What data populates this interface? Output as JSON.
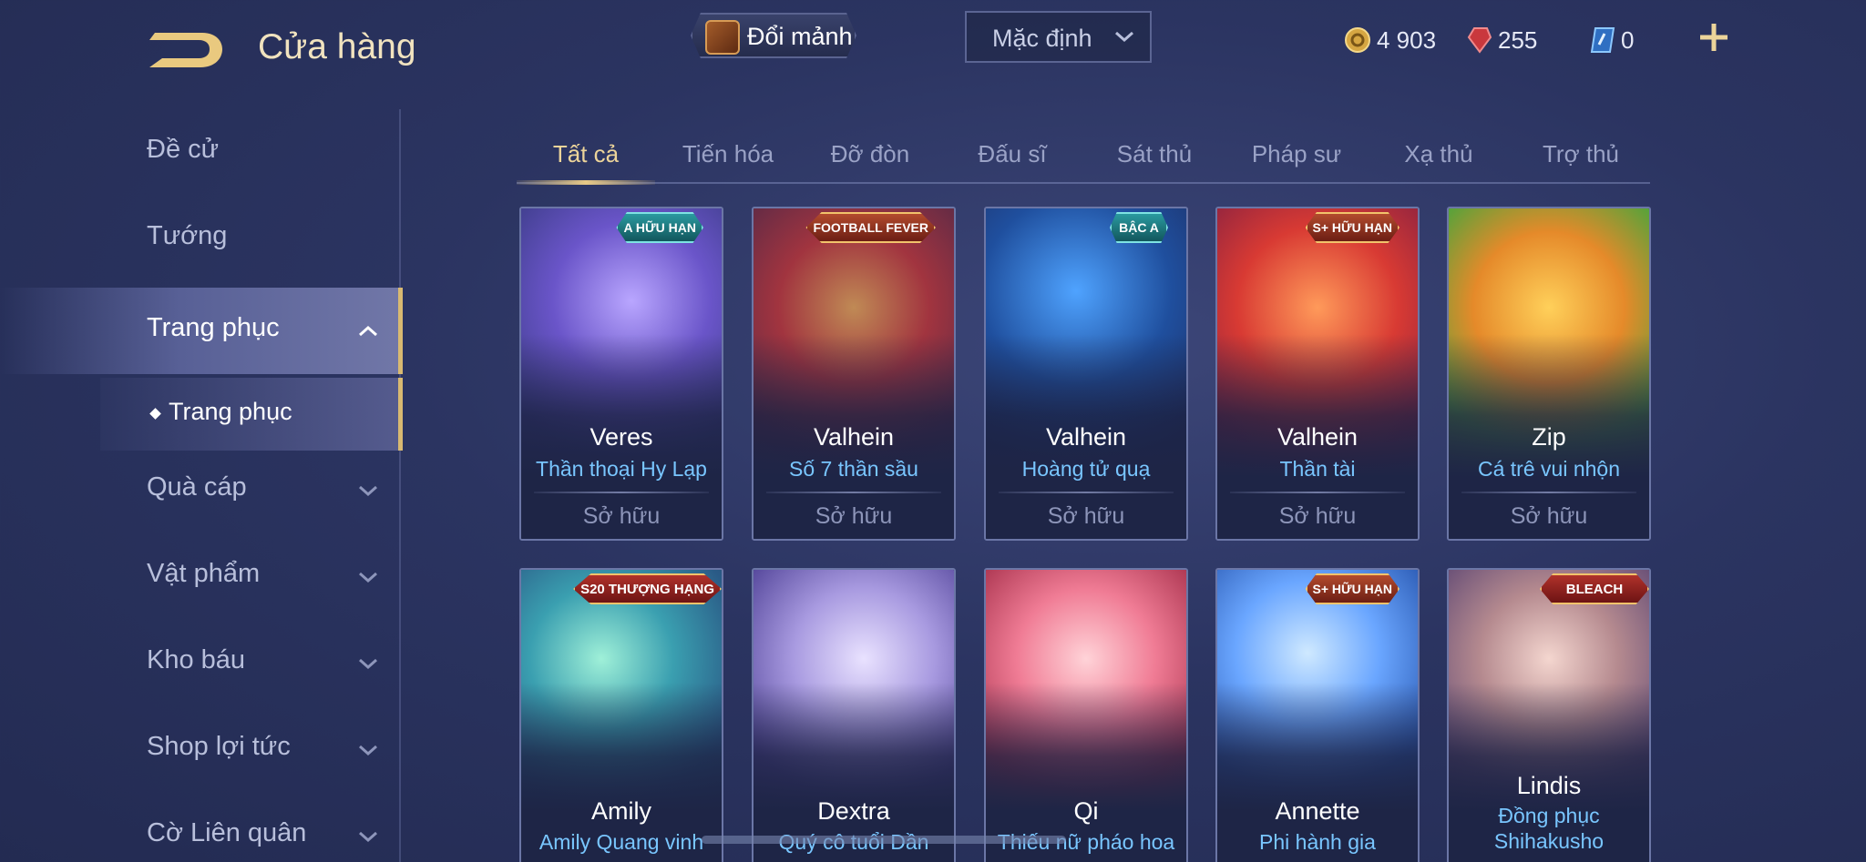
{
  "header": {
    "title": "Cửa hàng",
    "exchange_label": "Đổi mảnh",
    "sort_selected": "Mặc định",
    "currencies": [
      {
        "icon": "gold-coin-icon",
        "value": "4 903",
        "color": "#e0b04a"
      },
      {
        "icon": "red-gem-icon",
        "value": "255",
        "color": "#d9484a"
      },
      {
        "icon": "voucher-icon",
        "value": "0",
        "color": "#6fb9ff"
      }
    ]
  },
  "sidebar": {
    "items": [
      {
        "label": "Đề cử"
      },
      {
        "label": "Tướng"
      },
      {
        "label": "Trang phục"
      },
      {
        "label": "Trang phục"
      },
      {
        "label": "Quà cáp"
      },
      {
        "label": "Vật phẩm"
      },
      {
        "label": "Kho báu"
      },
      {
        "label": "Shop lợi tức"
      },
      {
        "label": "Cờ Liên quân"
      }
    ]
  },
  "tabs": [
    "Tất cả",
    "Tiến hóa",
    "Đỡ đòn",
    "Đấu sĩ",
    "Sát thủ",
    "Pháp sư",
    "Xạ thủ",
    "Trợ thủ"
  ],
  "cards": [
    {
      "hero": "Veres",
      "skin": "Thần thoại Hy Lạp",
      "status": "Sở hữu",
      "badge": "A HỮU HẠN"
    },
    {
      "hero": "Valhein",
      "skin": "Số 7 thần sầu",
      "status": "Sở hữu",
      "badge": "FOOTBALL FEVER"
    },
    {
      "hero": "Valhein",
      "skin": "Hoàng tử quạ",
      "status": "Sở hữu",
      "badge": "BẬC A"
    },
    {
      "hero": "Valhein",
      "skin": "Thần tài",
      "status": "Sở hữu",
      "badge": "S+ HỮU HẠN"
    },
    {
      "hero": "Zip",
      "skin": "Cá trê vui nhộn",
      "status": "Sở hữu",
      "badge": ""
    },
    {
      "hero": "Amily",
      "skin": "Amily Quang vinh",
      "badge": "S20 THƯỢNG HẠNG"
    },
    {
      "hero": "Dextra",
      "skin": "Quý cô tuổi Dần",
      "badge": ""
    },
    {
      "hero": "Qi",
      "skin": "Thiếu nữ pháo hoa",
      "badge": ""
    },
    {
      "hero": "Annette",
      "skin": "Phi hành gia",
      "badge": "S+ HỮU HẠN"
    },
    {
      "hero": "Lindis",
      "skin_line1": "Đồng phục",
      "skin_line2": "Shihakusho",
      "badge": "BLEACH"
    }
  ]
}
